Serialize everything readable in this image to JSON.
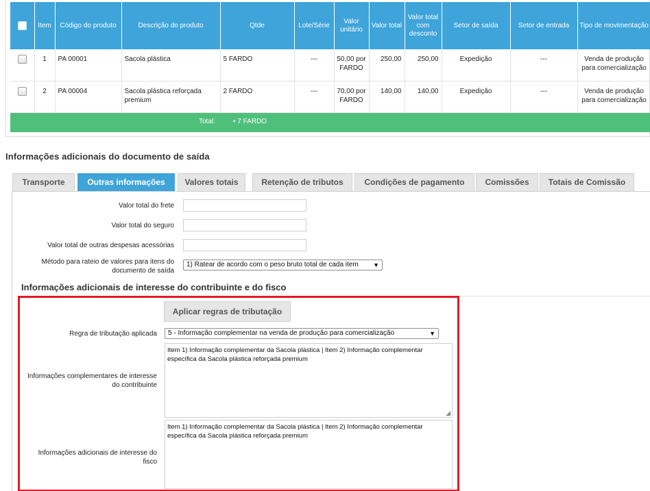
{
  "table": {
    "headers": [
      "Item",
      "Código do produto",
      "Descrição do produto",
      "Qtde",
      "Lote/Série",
      "Valor unitário",
      "Valor total",
      "Valor total com desconto",
      "Setor de saída",
      "Setor de entrada",
      "Tipo de movimentação"
    ],
    "rows": [
      {
        "item": "1",
        "codigo": "PA 00001",
        "descricao": "Sacola plástica",
        "qtde": "5 FARDO",
        "lote": "---",
        "valor_unitario": "50,00 por FARDO",
        "valor_total": "250,00",
        "valor_total_desconto": "250,00",
        "setor_saida": "Expedição",
        "setor_entrada": "---",
        "tipo_movimentacao": "Venda de produção para comercialização"
      },
      {
        "item": "2",
        "codigo": "PA 00004",
        "descricao": "Sacola plástica reforçada premium",
        "qtde": "2 FARDO",
        "lote": "---",
        "valor_unitario": "70,00 por FARDO",
        "valor_total": "140,00",
        "valor_total_desconto": "140,00",
        "setor_saida": "Expedição",
        "setor_entrada": "---",
        "tipo_movimentacao": "Venda de produção para comercialização"
      }
    ],
    "total_label": "Total:",
    "total_value": "• 7 FARDO"
  },
  "section": {
    "title": "Informações adicionais do documento de saída",
    "tabs": [
      "Transporte",
      "Outras informações",
      "Valores totais",
      "Retenção de tributos",
      "Condições de pagamento",
      "Comissões",
      "Totais de Comissão"
    ],
    "active_tab": "Outras informações"
  },
  "form": {
    "frete_label": "Valor total do frete",
    "frete_value": "",
    "seguro_label": "Valor total do seguro",
    "seguro_value": "",
    "despesas_label": "Valor total de outras despesas acessórias",
    "despesas_value": "",
    "metodo_label": "Método para rateio de valores para itens do documento de saída",
    "metodo_value": "1) Ratear de acordo com o peso bruto total de cada item"
  },
  "fisco": {
    "subtitle": "Informações adicionais de interesse do contribuinte e do fisco",
    "apply_button": "Aplicar regras de tributação",
    "regra_label": "Regra de tributação aplicada",
    "regra_value": "5 - Informação complementar na venda de produção para comercialização",
    "contribuinte_label": "Informações complementares de interesse do contribuinte",
    "contribuinte_value": "Item 1) Informação complementar da Sacola plástica | Item 2) Informação complementar específica da Sacola plástica reforçada premium",
    "fisco_label": "Informações adicionais de interesse do fisco",
    "fisco_value": "Item 1) Informação complementar da Sacola plástica | Item 2) Informação complementar específica da Sacola plástica reforçada premium"
  },
  "colors": {
    "header_blue": "#3ea4d9",
    "total_green": "#4fc07c",
    "highlight_red": "#e11a26",
    "tab_gray": "#e6e6e6"
  },
  "icons": [
    "checkbox",
    "dropdown-arrow-icon",
    "resize-grip-icon"
  ]
}
